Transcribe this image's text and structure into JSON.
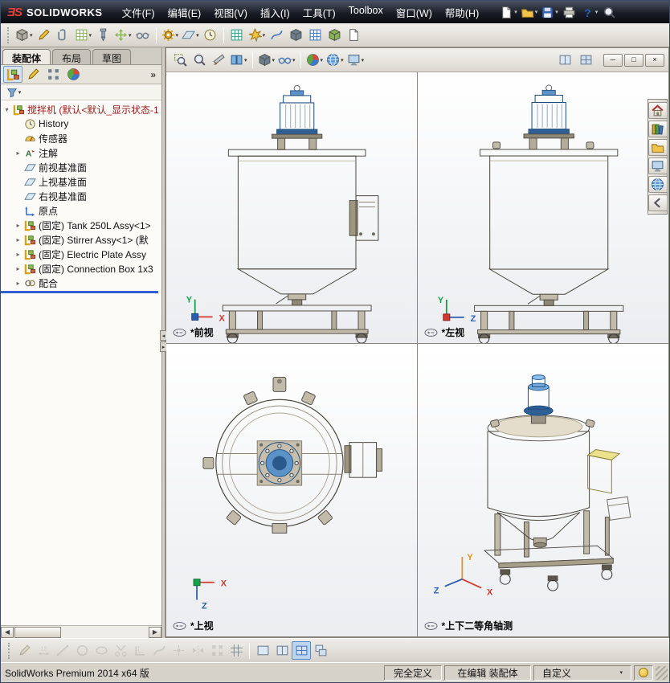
{
  "app": {
    "brand_mark": "ƎS",
    "brand_name": "SOLIDWORKS"
  },
  "menu": {
    "items": [
      {
        "id": "file",
        "label": "文件(F)"
      },
      {
        "id": "edit",
        "label": "编辑(E)"
      },
      {
        "id": "view",
        "label": "视图(V)"
      },
      {
        "id": "insert",
        "label": "插入(I)"
      },
      {
        "id": "tools",
        "label": "工具(T)"
      },
      {
        "id": "toolbox",
        "label": "Toolbox"
      },
      {
        "id": "window",
        "label": "窗口(W)"
      },
      {
        "id": "help",
        "label": "帮助(H)"
      }
    ]
  },
  "toolbars": {
    "title": [
      {
        "name": "new-document",
        "icon": "page",
        "dropdown": true
      },
      {
        "name": "open-document",
        "icon": "folder",
        "dropdown": true
      },
      {
        "name": "save-document",
        "icon": "floppy",
        "dropdown": true
      },
      {
        "name": "print-document",
        "icon": "print"
      },
      {
        "name": "help",
        "icon": "help",
        "dropdown": true
      },
      {
        "name": "search",
        "icon": "zoomfit"
      }
    ],
    "assembly": [
      {
        "name": "insert-components",
        "icon": "cube",
        "cls": "c-gray",
        "dropdown": true
      },
      {
        "name": "edit-component",
        "icon": "pencil",
        "cls": "c-gold"
      },
      {
        "name": "mate",
        "icon": "clip",
        "cls": "c-steel"
      },
      {
        "name": "linear-component-pattern",
        "icon": "grid",
        "cls": "c-green",
        "dropdown": true
      },
      {
        "name": "smart-fasteners",
        "icon": "bolt",
        "cls": "c-blue"
      },
      {
        "name": "move-component",
        "icon": "move",
        "cls": "c-green",
        "dropdown": true
      },
      {
        "name": "show-hidden-components",
        "icon": "eyewear",
        "cls": "c-steel"
      },
      {
        "sep": true
      },
      {
        "name": "assembly-features",
        "icon": "gear",
        "cls": "c-gold",
        "dropdown": true
      },
      {
        "name": "reference-geometry",
        "icon": "plane",
        "cls": "c-teal",
        "dropdown": true
      },
      {
        "name": "new-motion-study",
        "icon": "clock",
        "cls": "c-blue"
      },
      {
        "sep": true
      },
      {
        "name": "bill-of-materials",
        "icon": "grid",
        "cls": "c-teal"
      },
      {
        "name": "exploded-view",
        "icon": "burst",
        "cls": "c-gold",
        "dropdown": true
      },
      {
        "name": "explode-line-sketch",
        "icon": "spline",
        "cls": "c-blue"
      },
      {
        "name": "interference-detection",
        "icon": "cube",
        "cls": "c-steel"
      },
      {
        "name": "assembly-visualization",
        "icon": "grid",
        "cls": "c-blue"
      },
      {
        "name": "instant3d",
        "icon": "cube",
        "cls": "c-green"
      },
      {
        "name": "update-speedpak",
        "icon": "page",
        "cls": "c-gray"
      }
    ],
    "view": [
      {
        "name": "zoom-to-area",
        "icon": "zoomarea",
        "cls": "c-steel"
      },
      {
        "name": "zoom-to-fit",
        "icon": "zoomfit",
        "cls": "c-steel"
      },
      {
        "name": "section-view",
        "icon": "knife",
        "cls": "c-steel"
      },
      {
        "name": "view-orientation",
        "icon": "book",
        "cls": "c-blue",
        "dropdown": true
      },
      {
        "sep": true
      },
      {
        "name": "display-style",
        "icon": "cube",
        "cls": "c-steel",
        "dropdown": true
      },
      {
        "name": "hide-show-items",
        "icon": "eyewear",
        "cls": "c-blue",
        "dropdown": true
      },
      {
        "sep": true
      },
      {
        "name": "edit-appearance",
        "icon": "ball",
        "dropdown": true
      },
      {
        "name": "apply-scene",
        "icon": "globe",
        "cls": "c-blue",
        "dropdown": true
      },
      {
        "name": "view-settings",
        "icon": "monitor",
        "cls": "c-steel",
        "dropdown": true
      }
    ],
    "sketch": [
      {
        "name": "sketch",
        "icon": "pencil",
        "cls": "c-gray",
        "disabled": true
      },
      {
        "name": "smart-dimension",
        "icon": "dim",
        "cls": "c-gray",
        "disabled": true
      },
      {
        "name": "line",
        "icon": "line",
        "cls": "c-gray",
        "disabled": true
      },
      {
        "name": "circle",
        "icon": "circle",
        "cls": "c-gray",
        "disabled": true
      },
      {
        "name": "ellipse",
        "icon": "ellipse",
        "cls": "c-gray",
        "disabled": true
      },
      {
        "name": "trim-entities",
        "icon": "trim",
        "cls": "c-gray",
        "disabled": true
      },
      {
        "name": "convert-entities",
        "icon": "convert",
        "cls": "c-gray",
        "disabled": true
      },
      {
        "name": "spline",
        "icon": "spline",
        "cls": "c-gray",
        "disabled": true
      },
      {
        "name": "point",
        "icon": "point",
        "cls": "c-gray",
        "disabled": true
      },
      {
        "name": "mirror-entities",
        "icon": "mirror",
        "cls": "c-gray",
        "disabled": true
      },
      {
        "name": "linear-sketch-pattern",
        "icon": "pattern",
        "cls": "c-gray",
        "disabled": true
      },
      {
        "name": "display-grid",
        "icon": "gridsnap",
        "cls": "c-steel"
      },
      {
        "sep": true
      },
      {
        "name": "single-view",
        "icon": "vp1",
        "cls": "c-steel"
      },
      {
        "name": "two-view-horizontal",
        "icon": "vp2",
        "cls": "c-steel"
      },
      {
        "name": "four-view",
        "icon": "vp4",
        "cls": "c-blue",
        "active": true
      },
      {
        "name": "link-views",
        "icon": "vplink",
        "cls": "c-steel"
      }
    ],
    "taskpane": [
      {
        "name": "solidworks-resources",
        "icon": "house"
      },
      {
        "name": "design-library",
        "icon": "books",
        "cls": "c-green"
      },
      {
        "name": "file-explorer",
        "icon": "folder",
        "cls": "c-gold"
      },
      {
        "name": "view-palette",
        "icon": "monitor",
        "cls": "c-blue"
      },
      {
        "name": "appearances-scenes",
        "icon": "globe",
        "cls": "c-blue"
      },
      {
        "name": "collapse-taskpane",
        "icon": "arrowleft",
        "cls": "c-gray"
      }
    ],
    "pane_windows": [
      {
        "name": "viewport-previous",
        "icon": "vp2",
        "cls": "c-steel"
      },
      {
        "name": "viewport-layout",
        "icon": "vp4",
        "cls": "c-steel"
      }
    ]
  },
  "window_controls": [
    {
      "name": "minimize-window",
      "glyph": "─"
    },
    {
      "name": "restore-window",
      "glyph": "□"
    },
    {
      "name": "close-window",
      "glyph": "×"
    }
  ],
  "left_panel": {
    "tabs": [
      {
        "id": "assembly",
        "label": "装配体",
        "active": true
      },
      {
        "id": "layout",
        "label": "布局"
      },
      {
        "id": "sketch",
        "label": "草图"
      }
    ],
    "expand_chevron": "»",
    "tree": {
      "root_item": {
        "label": "搅拌机 (默认<默认_显示状态-1",
        "icon": "asm",
        "exp": "▾"
      },
      "items": [
        {
          "label": "History",
          "icon": "clock"
        },
        {
          "label": "传感器",
          "icon": "gauge"
        },
        {
          "label": "注解",
          "icon": "annot",
          "exp": "▸"
        },
        {
          "label": "前视基准面",
          "icon": "plane"
        },
        {
          "label": "上视基准面",
          "icon": "plane"
        },
        {
          "label": "右视基准面",
          "icon": "plane"
        },
        {
          "label": "原点",
          "icon": "origin"
        },
        {
          "label": "(固定) Tank 250L Assy<1>",
          "icon": "asm",
          "exp": "▸"
        },
        {
          "label": "(固定) Stirrer Assy<1> (默",
          "icon": "asm",
          "exp": "▸"
        },
        {
          "label": "(固定) Electric Plate Assy",
          "icon": "asm",
          "exp": "▸"
        },
        {
          "label": "(固定) Connection Box 1x3",
          "icon": "asm",
          "exp": "▸"
        },
        {
          "label": "配合",
          "icon": "mates",
          "exp": "▸"
        }
      ]
    }
  },
  "viewports": {
    "front": {
      "label": "*前视"
    },
    "left": {
      "label": "*左视"
    },
    "top": {
      "label": "*上视"
    },
    "iso": {
      "label": "*上下二等角轴测"
    }
  },
  "triad": {
    "x_label": "X",
    "y_label": "Y",
    "z_label": "Z"
  },
  "glyphs": {
    "dropdown": "▾",
    "left": "◀",
    "right": "▶",
    "split_left": "◂",
    "split_right": "▸"
  },
  "statusbar": {
    "app_info": "SolidWorks Premium 2014 x64 版",
    "define_state": "完全定义",
    "edit_state": "在编辑 装配体",
    "custom": "自定义"
  }
}
